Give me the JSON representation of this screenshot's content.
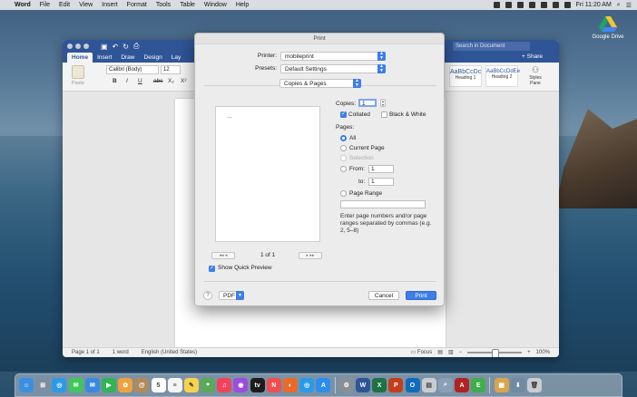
{
  "menubar": {
    "app_name": "Word",
    "items": [
      "File",
      "Edit",
      "View",
      "Insert",
      "Format",
      "Tools",
      "Table",
      "Window",
      "Help"
    ],
    "clock": "Fri 11:20 AM"
  },
  "desktop": {
    "google_drive_label": "Google Drive"
  },
  "word": {
    "search_placeholder": "Search in Document",
    "tabs": [
      "Home",
      "Insert",
      "Draw",
      "Design",
      "Lay"
    ],
    "share_label": "Share",
    "paste_label": "Paste",
    "font_name": "Calibri (Body)",
    "font_size": "12",
    "format_buttons": [
      "B",
      "I",
      "U",
      "abc",
      "X₂",
      "X²"
    ],
    "styles": [
      {
        "sample": "AaBbCcDc",
        "name": "Heading 1"
      },
      {
        "sample": "AaBbCcDdEe",
        "name": "Heading 2"
      }
    ],
    "styles_pane_label": "Styles Pane",
    "status": {
      "page": "Page 1 of 1",
      "words": "1 word",
      "language": "English (United States)",
      "focus": "Focus",
      "zoom": "100%"
    }
  },
  "print_dialog": {
    "title": "Print",
    "printer_label": "Printer:",
    "printer_value": "mobileprint",
    "presets_label": "Presets:",
    "presets_value": "Default Settings",
    "section_value": "Copies & Pages",
    "preview_mark": "…",
    "page_count": "1 of 1",
    "nav_first": "◂◂",
    "nav_prev": "◂",
    "nav_next": "▸",
    "nav_last": "▸▸",
    "show_quick_preview": "Show Quick Preview",
    "copies_label": "Copies:",
    "copies_value": "1",
    "collated_label": "Collated",
    "bw_label": "Black & White",
    "pages_label": "Pages:",
    "pages_all": "All",
    "pages_current": "Current Page",
    "pages_selection": "Selection",
    "pages_from": "From:",
    "from_value": "1",
    "pages_to": "to:",
    "to_value": "1",
    "pages_range": "Page Range",
    "range_value": "",
    "range_hint": "Enter page numbers and/or page ranges separated by commas (e.g. 2, 5–8)",
    "help_label": "?",
    "pdf_label": "PDF",
    "cancel_label": "Cancel",
    "print_label": "Print"
  },
  "dock": {
    "apps": [
      {
        "name": "finder",
        "color": "#3b8fe0",
        "glyph": "☺"
      },
      {
        "name": "launchpad",
        "color": "#7d8ea3",
        "glyph": "⊞"
      },
      {
        "name": "safari",
        "color": "#2a9ae8",
        "glyph": "◎"
      },
      {
        "name": "messages",
        "color": "#3fc85a",
        "glyph": "✉"
      },
      {
        "name": "mail",
        "color": "#3a89e0",
        "glyph": "✉"
      },
      {
        "name": "facetime",
        "color": "#2fb553",
        "glyph": "▶"
      },
      {
        "name": "photos",
        "color": "#f0a23a",
        "glyph": "✿"
      },
      {
        "name": "contacts",
        "color": "#b08a5a",
        "glyph": "@"
      },
      {
        "name": "calendar",
        "color": "#ffffff",
        "glyph": "5"
      },
      {
        "name": "reminders",
        "color": "#f5f5f5",
        "glyph": "≡"
      },
      {
        "name": "notes",
        "color": "#f7d24b",
        "glyph": "✎"
      },
      {
        "name": "maps",
        "color": "#5aa95a",
        "glyph": "⌖"
      },
      {
        "name": "music",
        "color": "#f2435d",
        "glyph": "♫"
      },
      {
        "name": "podcasts",
        "color": "#9b4de0",
        "glyph": "◉"
      },
      {
        "name": "tv",
        "color": "#1d1d1d",
        "glyph": "tv"
      },
      {
        "name": "news",
        "color": "#f24d4d",
        "glyph": "N"
      },
      {
        "name": "firefox",
        "color": "#e96b2a",
        "glyph": "◐"
      },
      {
        "name": "safari-2",
        "color": "#2a9ae8",
        "glyph": "◎"
      },
      {
        "name": "app-store",
        "color": "#2d8cf0",
        "glyph": "A"
      },
      {
        "name": "system-preferences",
        "color": "#8a8f96",
        "glyph": "⚙"
      },
      {
        "name": "word",
        "color": "#2f5597",
        "glyph": "W"
      },
      {
        "name": "excel",
        "color": "#1e7145",
        "glyph": "X"
      },
      {
        "name": "powerpoint",
        "color": "#c43e1c",
        "glyph": "P"
      },
      {
        "name": "outlook",
        "color": "#0f6cbd",
        "glyph": "O"
      },
      {
        "name": "printer",
        "color": "#c9ccd1",
        "glyph": "▤"
      },
      {
        "name": "preview",
        "color": "#8aa0b6",
        "glyph": "⌕"
      },
      {
        "name": "pdf-app",
        "color": "#b22222",
        "glyph": "A"
      },
      {
        "name": "evernote",
        "color": "#3fae4a",
        "glyph": "E"
      },
      {
        "name": "archive",
        "color": "#d8a64a",
        "glyph": "▦"
      },
      {
        "name": "downloads",
        "color": "#6f8aa5",
        "glyph": "⬇"
      },
      {
        "name": "trash",
        "color": "#c9ccd1",
        "glyph": "🗑"
      }
    ]
  }
}
